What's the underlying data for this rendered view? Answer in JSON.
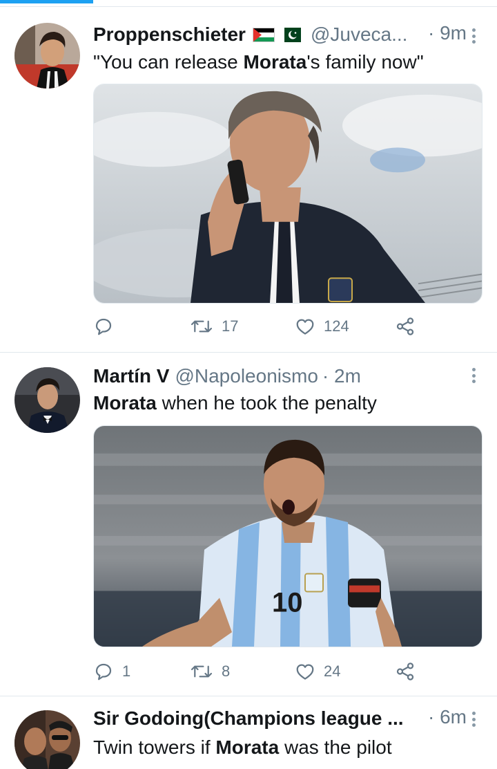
{
  "tweets": [
    {
      "name": "Proppenschieter",
      "flags": [
        "palestine-flag",
        "pakistan-flag"
      ],
      "handle": "@Juveca...",
      "time": "· 9m",
      "text_parts": [
        "\"You can release ",
        "Morata",
        "'s family now\""
      ],
      "media": "photo-man-on-phone-in-suit",
      "actions": {
        "reply": "",
        "retweets": "17",
        "likes": "124"
      }
    },
    {
      "name": "Martín V",
      "handle": "@Napoleonismo",
      "time": "· 2m",
      "text_parts": [
        "Morata",
        " when he took the penalty"
      ],
      "media": "photo-footballer-celebrating-number-10",
      "actions": {
        "reply": "1",
        "retweets": "8",
        "likes": "24"
      }
    },
    {
      "name": "Sir Godoing(Champions league ...",
      "handle": "",
      "time": "· 6m",
      "text_parts": [
        "Twin towers if ",
        "Morata",
        " was the pilot"
      ]
    }
  ],
  "icons": {
    "reply": "reply-icon",
    "retweet": "retweet-icon",
    "like": "heart-icon",
    "share": "share-icon",
    "menu": "more-vertical-icon"
  },
  "colors": {
    "accent": "#1da1f2",
    "text_primary": "#14171a",
    "text_secondary": "#657786",
    "divider": "#e1e8ed"
  }
}
